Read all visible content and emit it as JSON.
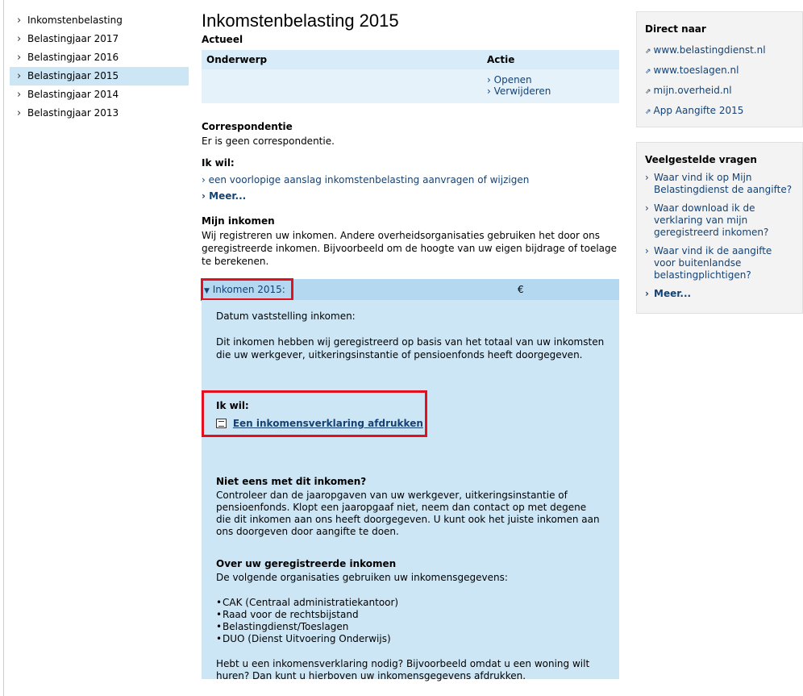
{
  "leftnav": {
    "items": [
      {
        "label": "Inkomstenbelasting"
      },
      {
        "label": "Belastingjaar 2017"
      },
      {
        "label": "Belastingjaar 2016"
      },
      {
        "label": "Belastingjaar 2015",
        "active": true
      },
      {
        "label": "Belastingjaar 2014"
      },
      {
        "label": "Belastingjaar 2013"
      }
    ]
  },
  "main": {
    "title": "Inkomstenbelasting 2015",
    "actueel": {
      "heading": "Actueel",
      "col_subject": "Onderwerp",
      "col_action": "Actie",
      "action_open": "Openen",
      "action_delete": "Verwijderen"
    },
    "correspondentie": {
      "heading": "Correspondentie",
      "text": "Er is geen correspondentie."
    },
    "ikwil": {
      "heading": "Ik wil:",
      "link": "een voorlopige aanslag inkomstenbelasting aanvragen of wijzigen",
      "more": "Meer..."
    },
    "mijn_inkomen": {
      "heading": "Mijn inkomen",
      "text": "Wij registreren uw inkomen. Andere overheidsorganisaties gebruiken het door ons geregistreerde inkomen. Bijvoorbeeld om de hoogte van uw eigen bijdrage of toelage te berekenen."
    },
    "inkomen_panel": {
      "toggle_label": "Inkomen 2015:",
      "currency": "€",
      "datum_label": "Datum vaststelling inkomen:",
      "basis_text": "Dit inkomen hebben wij geregistreerd op basis van het totaal van uw inkomsten die uw werkgever, uitkeringsinstantie of pensioenfonds heeft doorgegeven.",
      "ikwil_heading": "Ik wil:",
      "print_link": "Een inkomensverklaring afdrukken",
      "niet_eens_heading": "Niet eens met dit inkomen?",
      "niet_eens_text": "Controleer dan de jaaropgaven van uw werkgever, uitkeringsinstantie of pensioenfonds. Klopt een jaaropgaaf niet, neem dan contact op met degene die dit inkomen aan ons heeft doorgegeven. U kunt ook het juiste inkomen aan ons doorgeven door aangifte te doen.",
      "over_heading": "Over uw geregistreerde inkomen",
      "over_text": "De volgende organisaties gebruiken uw inkomensgegevens:",
      "orgs": [
        "CAK (Centraal administratiekantoor)",
        "Raad voor de rechtsbijstand",
        "Belastingdienst/Toeslagen",
        "DUO (Dienst Uitvoering Onderwijs)"
      ],
      "extra_text": "Hebt u een inkomensverklaring nodig? Bijvoorbeeld omdat u een woning wilt huren? Dan kunt u hierboven uw inkomensgegevens afdrukken."
    }
  },
  "sidebar": {
    "direct": {
      "heading": "Direct naar",
      "links": [
        "www.belastingdienst.nl",
        "www.toeslagen.nl",
        "mijn.overheid.nl",
        "App Aangifte 2015"
      ]
    },
    "faq": {
      "heading": "Veelgestelde vragen",
      "questions": [
        "Waar vind ik op Mijn Belastingdienst de aangifte?",
        "Waar download ik de verklaring van mijn geregistreerd inkomen?",
        "Waar vind ik de aangifte voor buitenlandse belastingplichtigen?"
      ],
      "more": "Meer..."
    }
  }
}
